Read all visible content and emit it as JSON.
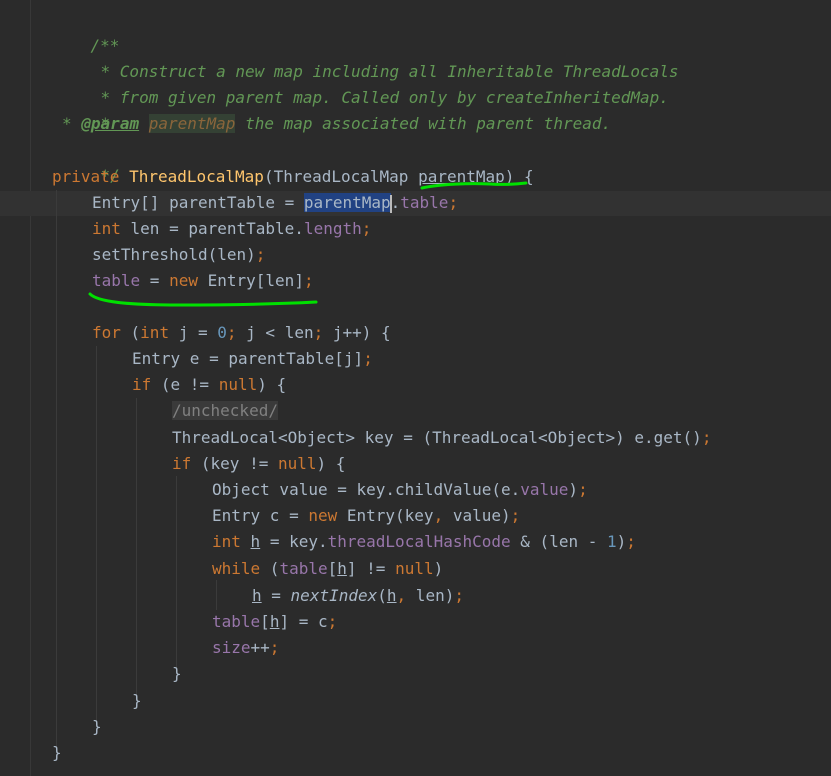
{
  "code": {
    "l1": "/**",
    "l2": "* Construct a new map including all Inheritable ThreadLocals",
    "l3": "* from given parent map. Called only by createInheritedMap.",
    "l4": "*",
    "l5_star": "*",
    "l5_tag": "@param",
    "l5_param": "parentMap",
    "l5_rest": "the map associated with parent thread.",
    "l6": "*/",
    "l7_kw": "private",
    "l7_name": "ThreadLocalMap",
    "l7_sig": "(ThreadLocalMap ",
    "l7_param": "parentMap",
    "l7_end": ") {",
    "l8_a": "Entry[] parentTable = ",
    "l8_sel": "parentMap",
    "l8_dot": ".",
    "l8_fld": "table",
    "l8_semi": ";",
    "l9_kw": "int",
    "l9_a": " len = parentTable.",
    "l9_fld": "length",
    "l9_semi": ";",
    "l10_a": "setThreshold(len)",
    "l10_semi": ";",
    "l11_fld": "table",
    "l11_a": " = ",
    "l11_kw": "new",
    "l11_b": " Entry[len]",
    "l11_semi": ";",
    "l12_kw": "for",
    "l12_a": " (",
    "l12_kw2": "int",
    "l12_b": " j = ",
    "l12_num": "0",
    "l12_semi1": ";",
    "l12_c": " j < len",
    "l12_semi2": ";",
    "l12_d": " j++) {",
    "l13_a": "Entry e = parentTable[j]",
    "l13_semi": ";",
    "l14_kw": "if",
    "l14_a": " (e != ",
    "l14_kw2": "null",
    "l14_b": ") {",
    "l15": "/unchecked/",
    "l16_a": "ThreadLocal<Object> key = (ThreadLocal<Object>) e.get()",
    "l16_semi": ";",
    "l17_kw": "if",
    "l17_a": " (key != ",
    "l17_kw2": "null",
    "l17_b": ") {",
    "l18_a": "Object value = key.childValue(e.",
    "l18_fld": "value",
    "l18_b": ")",
    "l18_semi": ";",
    "l19_a": "Entry c = ",
    "l19_kw": "new",
    "l19_b": " Entry(key",
    "l19_comma": ",",
    "l19_c": " value)",
    "l19_semi": ";",
    "l20_kw": "int",
    "l20_h": "h",
    "l20_a": " = key.",
    "l20_fld": "threadLocalHashCode",
    "l20_b": " & (len - ",
    "l20_num": "1",
    "l20_c": ")",
    "l20_semi": ";",
    "l21_kw": "while",
    "l21_a": " (",
    "l21_fld": "table",
    "l21_b": "[",
    "l21_h": "h",
    "l21_c": "] != ",
    "l21_kw2": "null",
    "l21_d": ")",
    "l22_h": "h",
    "l22_a": " = ",
    "l22_fn": "nextIndex",
    "l22_b": "(",
    "l22_h2": "h",
    "l22_comma": ",",
    "l22_c": " len)",
    "l22_semi": ";",
    "l23_fld": "table",
    "l23_a": "[",
    "l23_h": "h",
    "l23_b": "] = c",
    "l23_semi": ";",
    "l24_fld": "size",
    "l24_a": "++",
    "l24_semi": ";",
    "brace": "}"
  },
  "colors": {
    "background": "#2b2b2b",
    "keyword": "#cc7832",
    "method": "#ffc66d",
    "field": "#9876aa",
    "number": "#6897bb",
    "doc": "#629755",
    "selection": "#214283",
    "annotation_marker": "#00e000"
  }
}
